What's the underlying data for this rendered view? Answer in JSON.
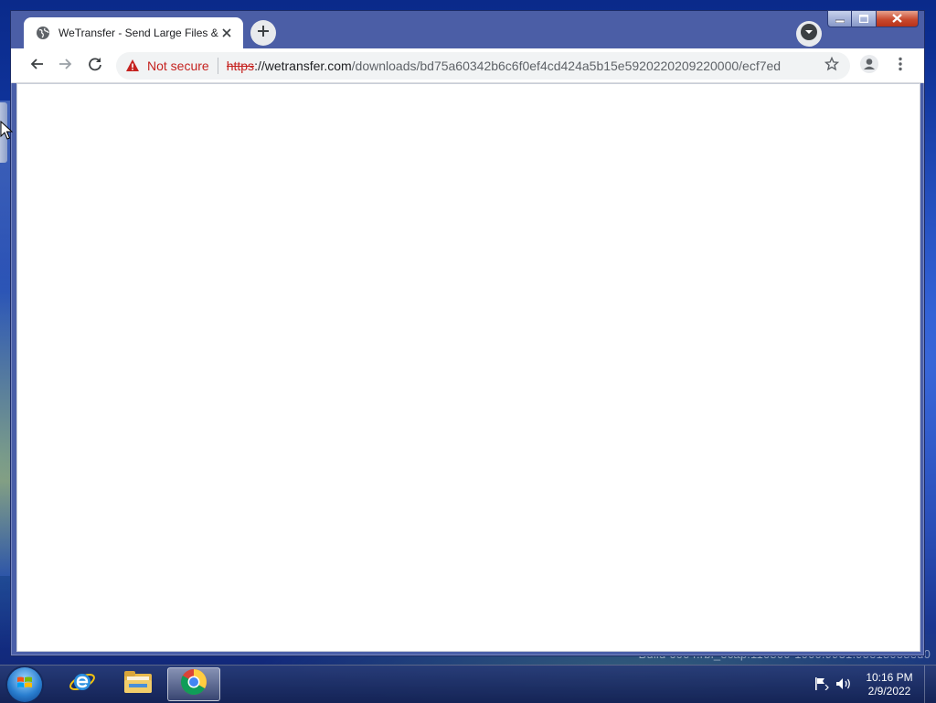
{
  "browser": {
    "tab": {
      "title": "WeTransfer - Send Large Files &"
    },
    "omnibox": {
      "security_label": "Not secure",
      "url_scheme": "https",
      "url_host": "://wetransfer.com",
      "url_path": "/downloads/bd75a60342b6c6f0ef4cd424a5b15e5920220209220000/ecf7ed"
    }
  },
  "desktop": {
    "build_text": "Build 6004.rbl_ecap.110800-1000.9931.95e18058ed0"
  },
  "taskbar": {
    "items": [
      {
        "name": "internet-explorer"
      },
      {
        "name": "windows-explorer"
      },
      {
        "name": "google-chrome",
        "active": true
      }
    ],
    "clock": {
      "time": "10:16 PM",
      "date": "2/9/2022"
    }
  },
  "colors": {
    "security_warning": "#c5221f",
    "window_frame": "#4b5ea6",
    "omnibox_bg": "#f1f3f4"
  },
  "icons": [
    "globe-icon",
    "close-icon",
    "plus-icon",
    "chevron-down-icon",
    "back-arrow-icon",
    "forward-arrow-icon",
    "reload-icon",
    "warning-icon",
    "star-icon",
    "account-icon",
    "kebab-menu-icon",
    "minimize-icon",
    "maximize-icon",
    "window-close-icon",
    "windows-logo-icon",
    "ie-icon",
    "folder-icon",
    "chrome-icon",
    "flag-icon",
    "speaker-icon"
  ]
}
